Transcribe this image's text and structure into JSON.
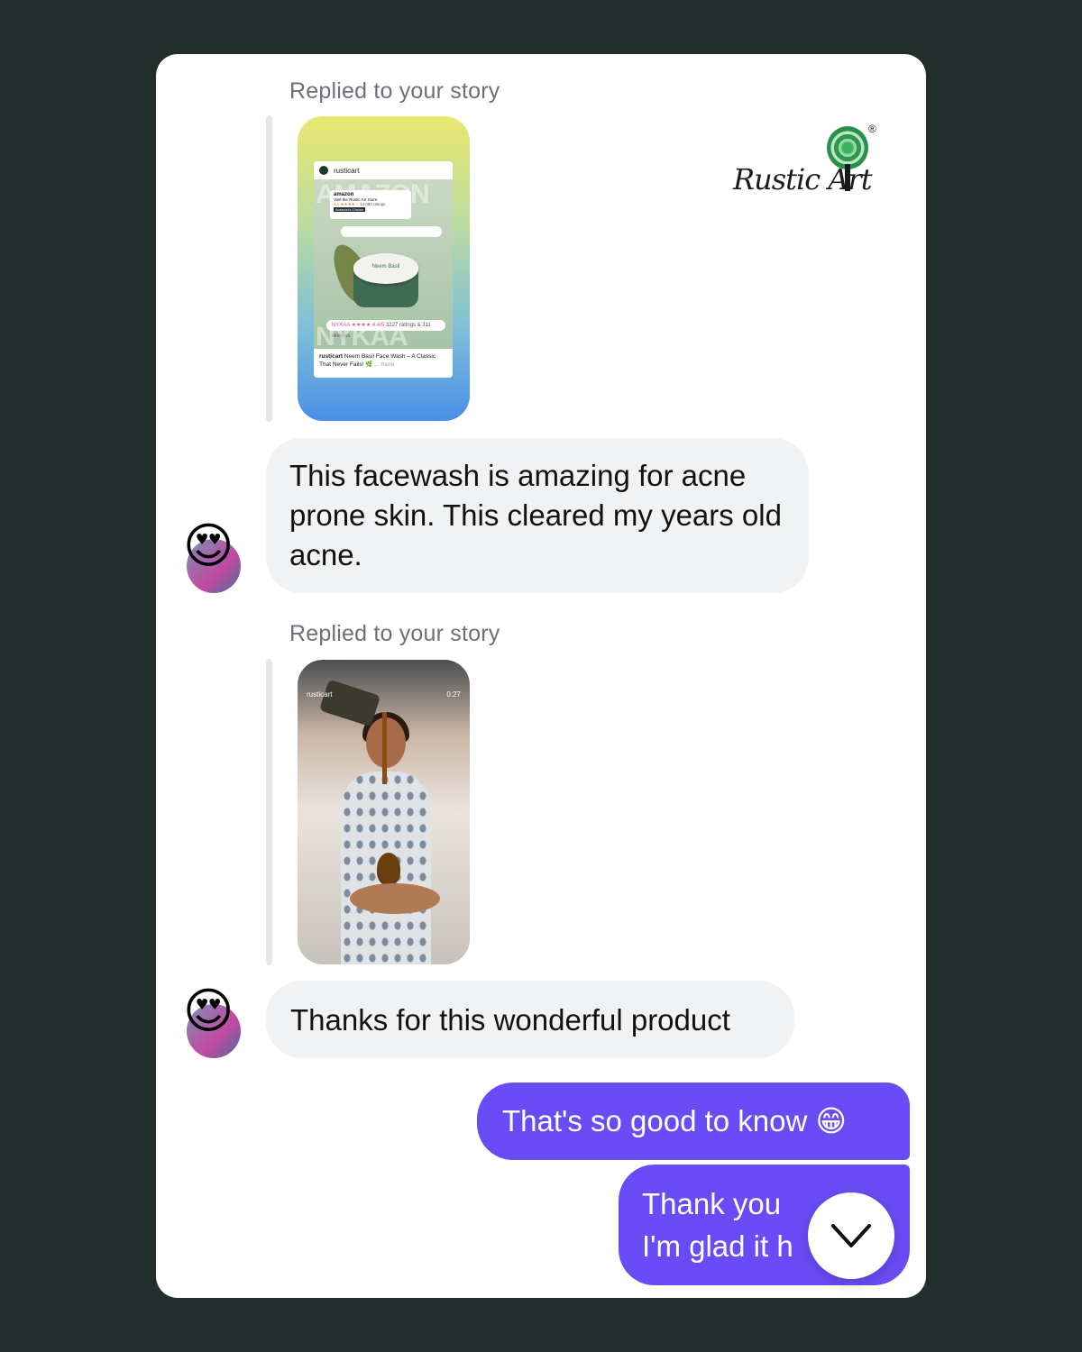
{
  "brand": {
    "logo_text": "Rustic Art",
    "reg_mark": "®"
  },
  "messages": {
    "story_reply_1": {
      "label": "Replied to your story",
      "story": {
        "account": "rusticart",
        "amazon_title": "amazon",
        "amazon_store": "Visit the Rustic Art Store",
        "amazon_rating": "4.1 ★★★★☆",
        "amazon_ratings_count": "14,092 ratings",
        "amazon_badge": "Amazon's Choice",
        "watermark_top": "AMAZON",
        "watermark_bottom": "NYKAA",
        "nykaa_label": "NYKAA ★★★★ 4.4/5",
        "nykaa_counts": "3227 ratings & 311 reviews",
        "jar_label": "Neem Basil",
        "caption_account": "rusticart",
        "caption": "Neem Basil Face Wash – A Classic That Never Fails! 🌿",
        "caption_more": "... more"
      }
    },
    "msg_1": {
      "text": "This facewash is amazing for acne prone skin. This cleared my years old acne.",
      "reaction": "😍"
    },
    "story_reply_2": {
      "label": "Replied to your story",
      "story": {
        "account": "rusticart",
        "duration": "0:27"
      }
    },
    "msg_2": {
      "text": "Thanks for this wonderful product",
      "reaction": "😍"
    },
    "reply_1": {
      "text": "That's so good to know 😁"
    },
    "reply_2": {
      "line1": "Thank you",
      "line2": "I'm glad it h"
    }
  },
  "icons": {
    "scroll_down": "chevron-down-icon"
  },
  "colors": {
    "background": "#212e2b",
    "outgoing_bubble": "#6a4cf6",
    "incoming_bubble": "#f1f2f4"
  }
}
